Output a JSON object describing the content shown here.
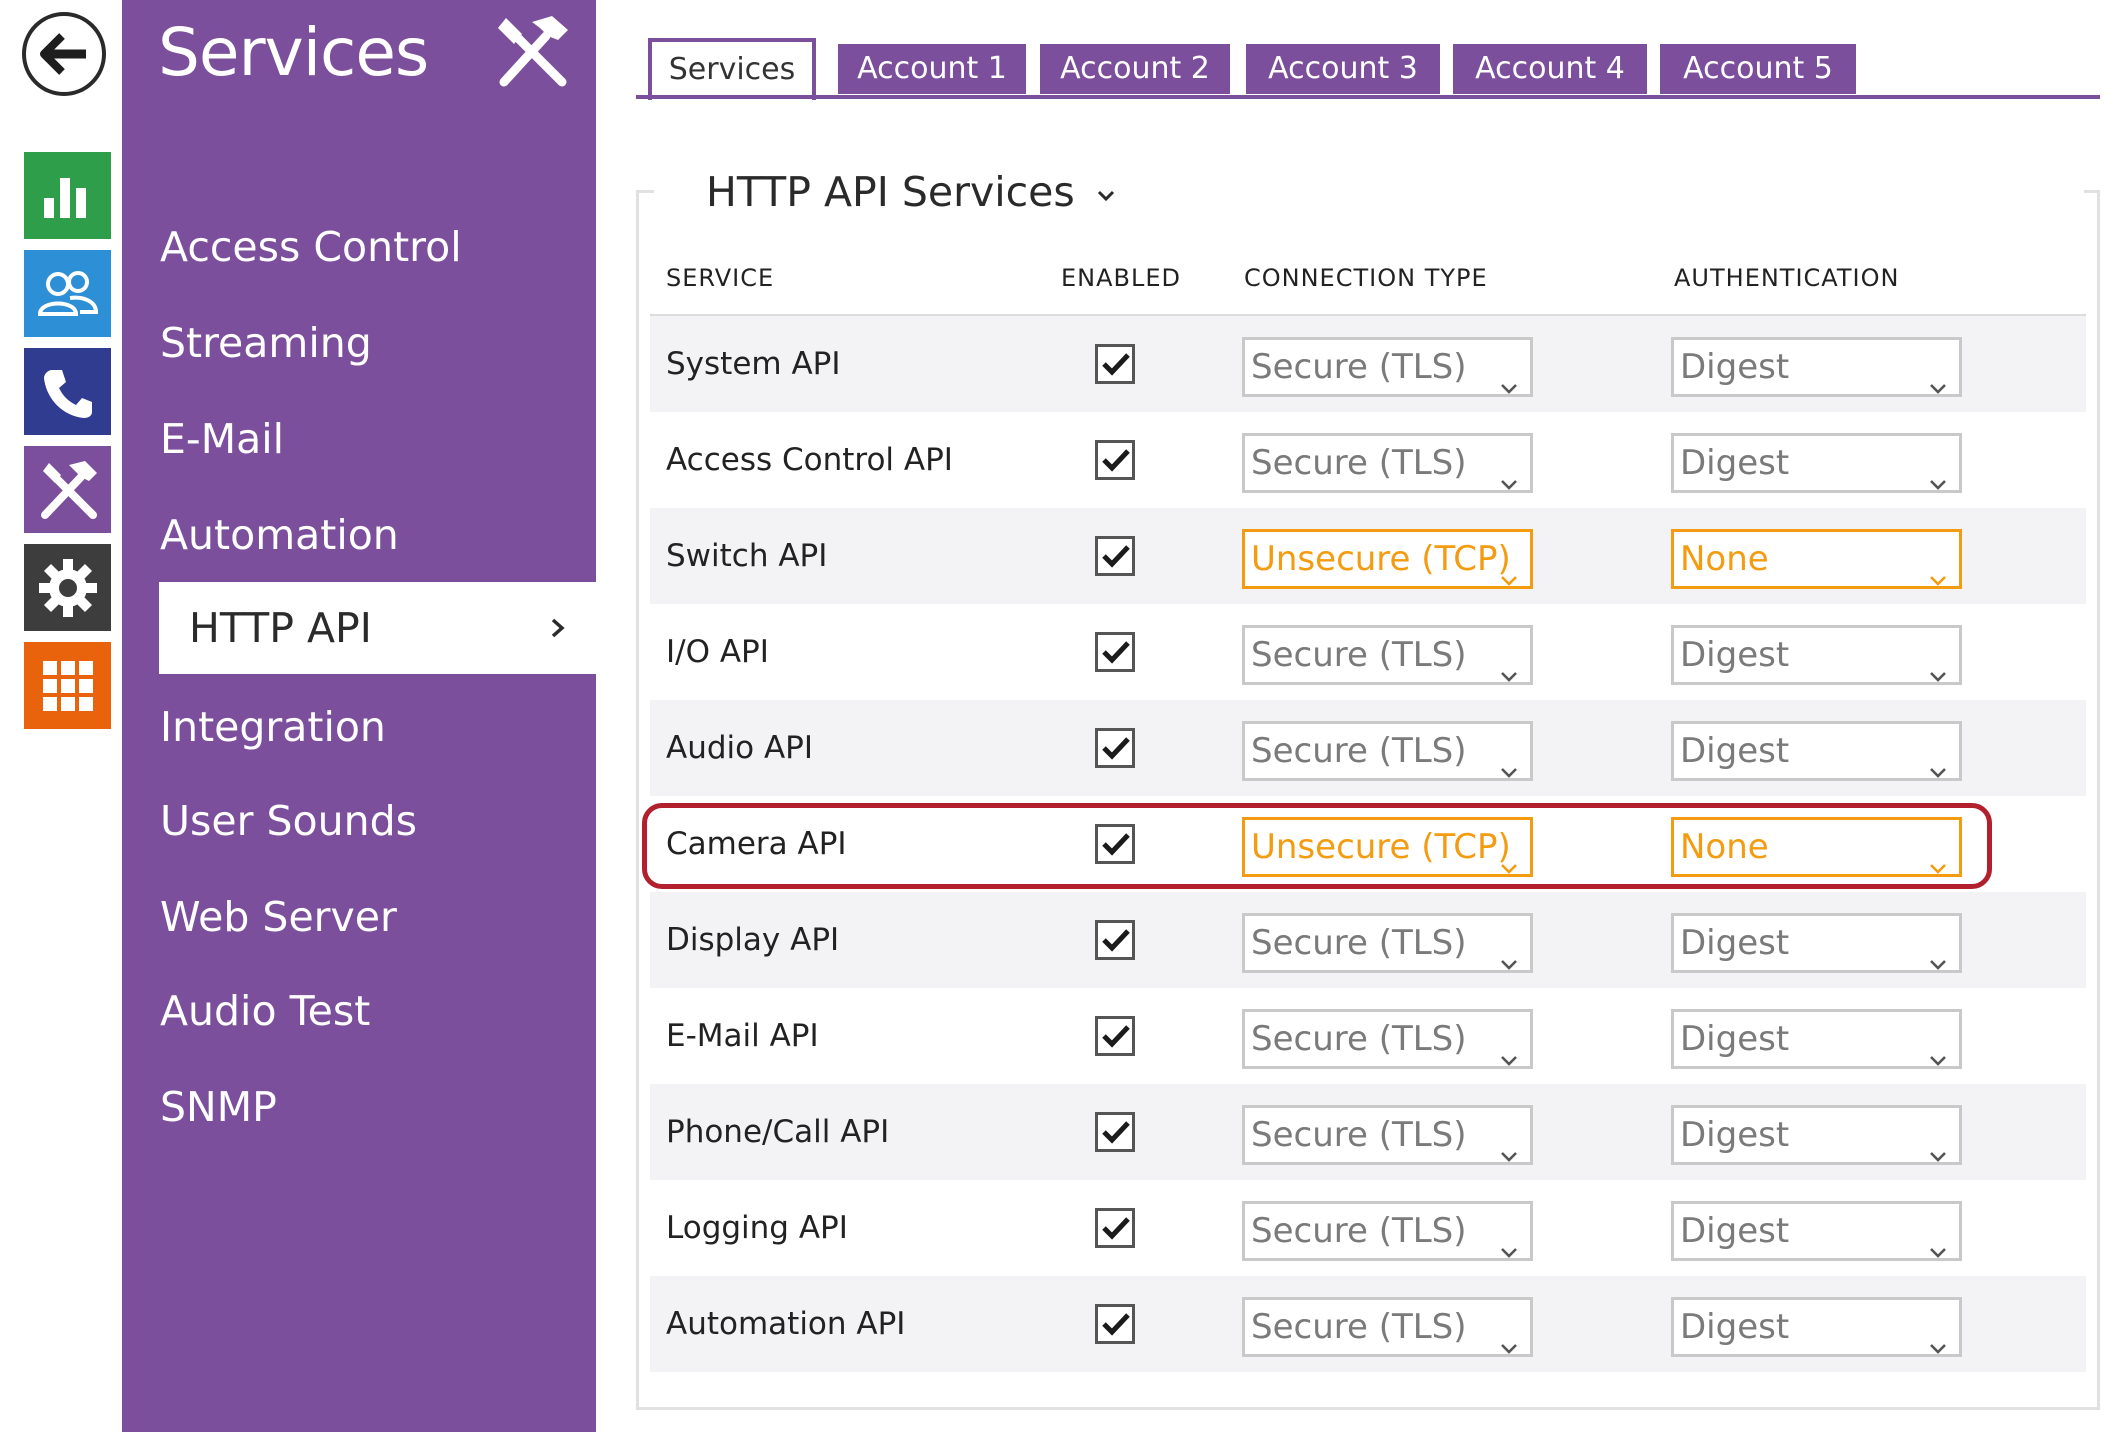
{
  "sidebar": {
    "title": "Services",
    "items": [
      {
        "label": "Access Control"
      },
      {
        "label": "Streaming"
      },
      {
        "label": "E-Mail"
      },
      {
        "label": "Automation"
      },
      {
        "label": "HTTP API",
        "active": true
      },
      {
        "label": "Integration"
      },
      {
        "label": "User Sounds"
      },
      {
        "label": "Web Server"
      },
      {
        "label": "Audio Test"
      },
      {
        "label": "SNMP"
      }
    ]
  },
  "rail_icons": [
    "back-arrow-icon",
    "status-chart-icon",
    "directory-users-icon",
    "phone-icon",
    "services-tools-icon",
    "settings-gear-icon",
    "system-grid-icon"
  ],
  "colors": {
    "brand_purple": "#7b4f9b",
    "warning_orange": "#f39c12",
    "highlight_red": "#b21f2d"
  },
  "tabs": [
    "Services",
    "Account 1",
    "Account 2",
    "Account 3",
    "Account 4",
    "Account 5"
  ],
  "section": {
    "title": "HTTP API Services"
  },
  "table": {
    "headers": {
      "service": "SERVICE",
      "enabled": "ENABLED",
      "connection": "CONNECTION TYPE",
      "auth": "AUTHENTICATION"
    },
    "rows": [
      {
        "service": "System API",
        "enabled": true,
        "connection": "Secure (TLS)",
        "auth": "Digest"
      },
      {
        "service": "Access Control API",
        "enabled": true,
        "connection": "Secure (TLS)",
        "auth": "Digest"
      },
      {
        "service": "Switch API",
        "enabled": true,
        "connection": "Unsecure (TCP)",
        "auth": "None"
      },
      {
        "service": "I/O API",
        "enabled": true,
        "connection": "Secure (TLS)",
        "auth": "Digest"
      },
      {
        "service": "Audio API",
        "enabled": true,
        "connection": "Secure (TLS)",
        "auth": "Digest"
      },
      {
        "service": "Camera API",
        "enabled": true,
        "connection": "Unsecure (TCP)",
        "auth": "None"
      },
      {
        "service": "Display API",
        "enabled": true,
        "connection": "Secure (TLS)",
        "auth": "Digest"
      },
      {
        "service": "E-Mail API",
        "enabled": true,
        "connection": "Secure (TLS)",
        "auth": "Digest"
      },
      {
        "service": "Phone/Call API",
        "enabled": true,
        "connection": "Secure (TLS)",
        "auth": "Digest"
      },
      {
        "service": "Logging API",
        "enabled": true,
        "connection": "Secure (TLS)",
        "auth": "Digest"
      },
      {
        "service": "Automation API",
        "enabled": true,
        "connection": "Secure (TLS)",
        "auth": "Digest"
      }
    ]
  }
}
